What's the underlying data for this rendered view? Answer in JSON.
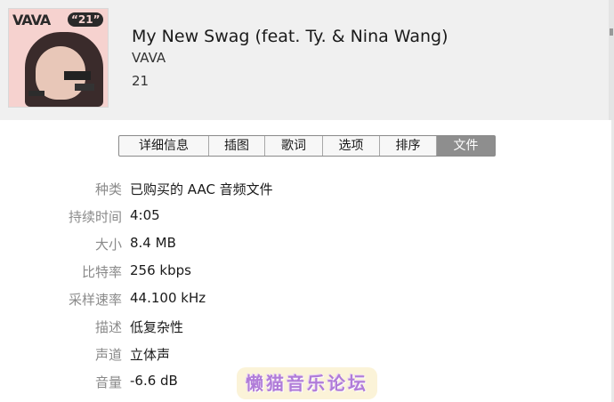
{
  "header": {
    "artwork": {
      "logo_text": "VAVA",
      "badge_text": "“21”"
    },
    "song_title": "My New Swag (feat. Ty. & Nina Wang)",
    "artist": "VAVA",
    "album": "21"
  },
  "tabs": [
    {
      "label": "详细信息",
      "active": false
    },
    {
      "label": "插图",
      "active": false
    },
    {
      "label": "歌词",
      "active": false
    },
    {
      "label": "选项",
      "active": false
    },
    {
      "label": "排序",
      "active": false
    },
    {
      "label": "文件",
      "active": true
    }
  ],
  "file_info": {
    "kind_label": "种类",
    "kind_value": "已购买的 AAC 音频文件",
    "duration_label": "持续时间",
    "duration_value": "4:05",
    "size_label": "大小",
    "size_value": "8.4 MB",
    "bitrate_label": "比特率",
    "bitrate_value": "256 kbps",
    "samplerate_label": "采样速率",
    "samplerate_value": "44.100 kHz",
    "description_label": "描述",
    "description_value": "低复杂性",
    "channels_label": "声道",
    "channels_value": "立体声",
    "volume_label": "音量",
    "volume_value": "-6.6 dB"
  },
  "watermark": {
    "text": "懒猫音乐论坛"
  },
  "colors": {
    "header_bg": "#f0f0f0",
    "active_tab_bg": "#8e8e8e",
    "label_text": "#8a8a8a",
    "watermark_text": "#b07cd8"
  }
}
